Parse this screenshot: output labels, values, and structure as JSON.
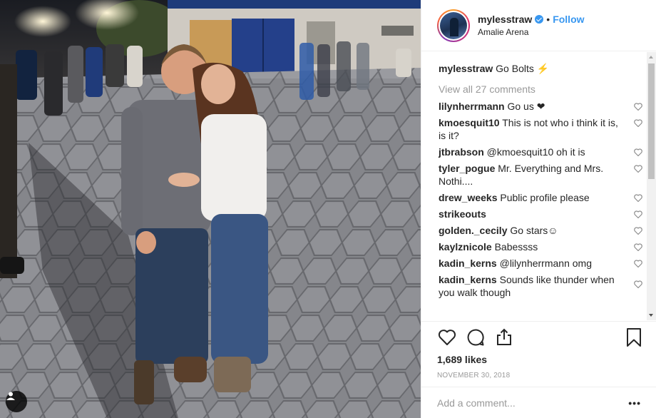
{
  "post": {
    "username": "mylesstraw",
    "follow_label": "Follow",
    "separator": "•",
    "location": "Amalie Arena",
    "caption_user": "mylesstraw",
    "caption_text": "Go Bolts ⚡",
    "view_all": "View all 27 comments",
    "likes": "1,689 likes",
    "date": "NOVEMBER 30, 2018",
    "add_comment_placeholder": "Add a comment...",
    "more_label": "•••"
  },
  "comments": [
    {
      "user": "lilynherrmann",
      "text": "Go us ❤"
    },
    {
      "user": "kmoesquit10",
      "text": "This is not who i think it is, is it?"
    },
    {
      "user": "jtbrabson",
      "text": "@kmoesquit10 oh it is"
    },
    {
      "user": "tyler_pogue",
      "text": "Mr. Everything and Mrs. Nothi...."
    },
    {
      "user": "drew_weeks",
      "text": "Public profile please"
    },
    {
      "user": "strikeouts",
      "text": ""
    },
    {
      "user": "golden._cecily",
      "text": "Go stars☺"
    },
    {
      "user": "kaylznicole",
      "text": "Babessss"
    },
    {
      "user": "kadin_kerns",
      "text": "@lilynherrmann omg"
    },
    {
      "user": "kadin_kerns",
      "text": "Sounds like thunder when you walk though"
    }
  ],
  "icons": {
    "like": "heart-icon",
    "comment": "comment-bubble-icon",
    "share": "share-icon",
    "save": "bookmark-icon",
    "verified": "verified-badge-icon",
    "tag": "user-tag-icon"
  },
  "colors": {
    "link_blue": "#3897f0",
    "text": "#262626",
    "muted": "#999999",
    "border": "#efefef"
  }
}
